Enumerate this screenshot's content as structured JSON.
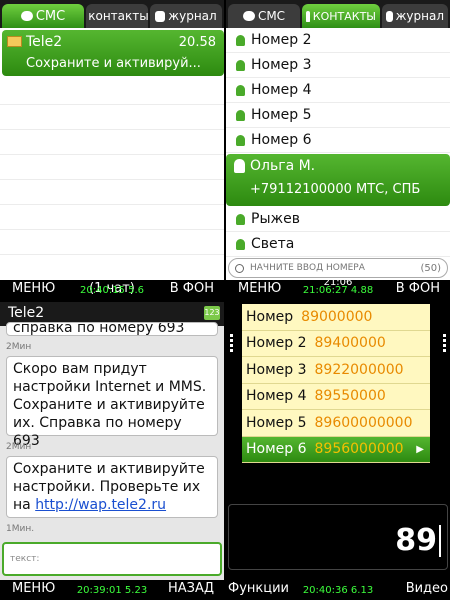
{
  "tabs": {
    "sms": "СМС",
    "contacts": "контакты",
    "contacts_active": "КОНТАКТЫ",
    "journal": "журнал"
  },
  "inbox": {
    "sender": "Tele2",
    "time": "20.58",
    "preview": "Сохраните и активируй..."
  },
  "softkeys_1": {
    "left": "МЕНЮ",
    "middle": "(1 чат)",
    "right": "В ФОН",
    "overlay": "20:40:15 5.6"
  },
  "contacts": {
    "top": [
      "Номер 2",
      "Номер 3",
      "Номер 4",
      "Номер 5",
      "Номер 6"
    ],
    "selected_name": "Ольга М.",
    "selected_phone": "+79112100000  МТС, СПБ",
    "bottom": [
      "Рыжев",
      "Света"
    ],
    "search_placeholder": "НАЧНИТЕ ВВОД НОМЕРА",
    "search_count": "(50)"
  },
  "softkeys_2": {
    "left": "МЕНЮ",
    "right": "В ФОН",
    "overlay": "21:06:27 4.88",
    "clock": "21:06"
  },
  "chat": {
    "title": "Tele2",
    "badge": "123",
    "cut_text": "справка по номеру 693",
    "t1": "2Мин",
    "msg1": "Скоро вам придут настройки Internet и MMS. Сохраните и активируйте их. Справка по номеру 693",
    "t2": "2Мин",
    "msg2_text": "Сохраните и активируйте настройки. Проверьте их на ",
    "msg2_link": "http://wap.tele2.ru",
    "t3": "1Мин.",
    "input_placeholder": "текст:"
  },
  "softkeys_3": {
    "left": "МЕНЮ",
    "right": "НАЗАД",
    "overlay": "20:39:01 5.23"
  },
  "dialer": {
    "items": [
      {
        "name": "Номер",
        "num": "89000000"
      },
      {
        "name": "Номер 2",
        "num": "89400000"
      },
      {
        "name": "Номер 3",
        "num": "8922000000"
      },
      {
        "name": "Номер 4",
        "num": "89550000"
      },
      {
        "name": "Номер 5",
        "num": "89600000000"
      },
      {
        "name": "Номер 6",
        "num": "8956000000"
      }
    ],
    "typed": "89"
  },
  "softkeys_4": {
    "left": "Функции",
    "right": "Видео",
    "overlay": "20:40:36 6.13"
  }
}
